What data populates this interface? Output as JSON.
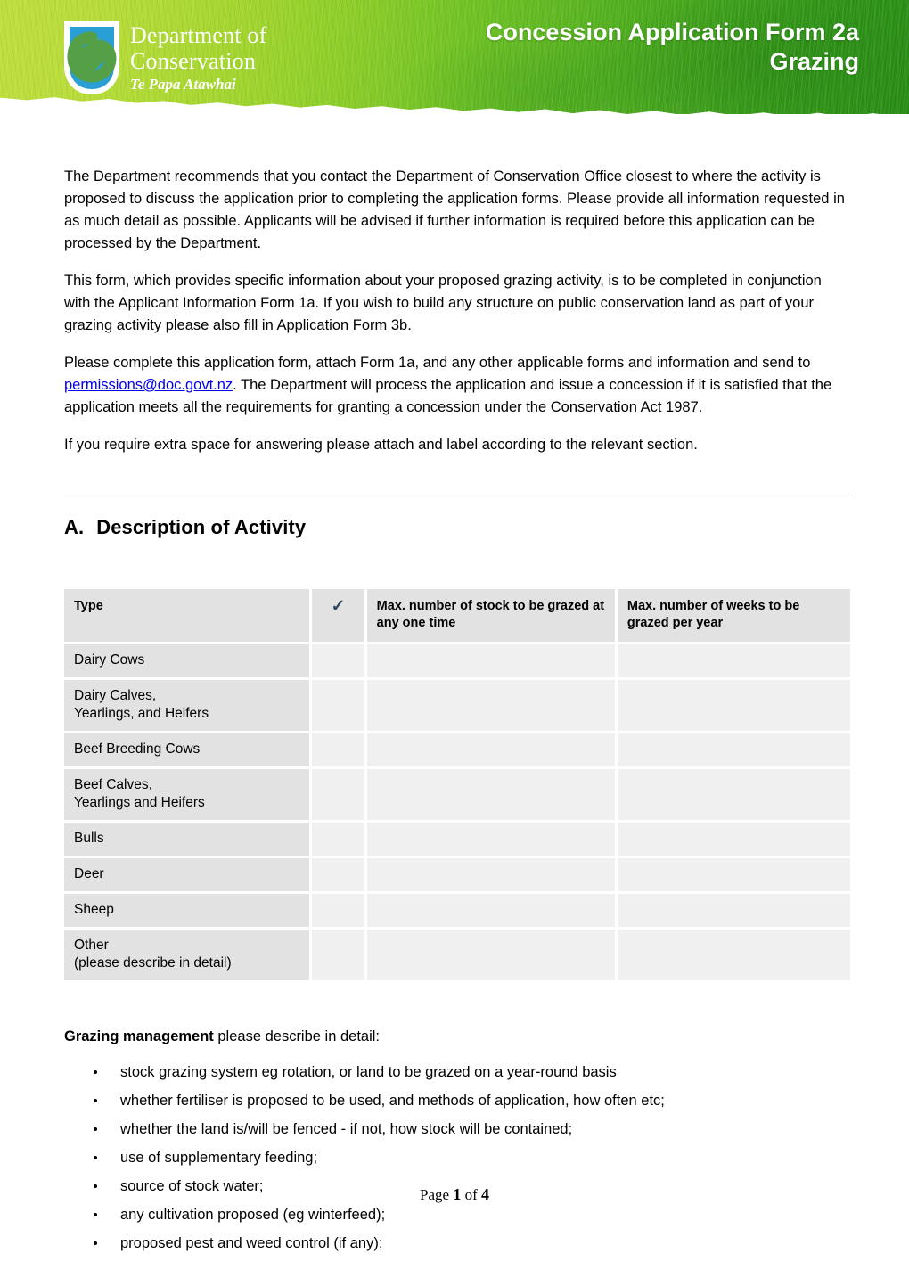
{
  "header": {
    "logo": {
      "line1": "Department of",
      "line2": "Conservation",
      "line3": "Te Papa Atawhai",
      "shield_blue": "#2a9fd6",
      "shield_green": "#55a046"
    },
    "title_line1": "Concession Application Form 2a",
    "title_line2": "Grazing",
    "banner_light_green": "#bede3c",
    "banner_dark_green": "#278c14"
  },
  "intro": {
    "p1": "The Department recommends that you contact the Department of Conservation Office closest to where the activity is proposed to discuss the application prior to completing the application forms.  Please provide all information requested in as much detail as possible.  Applicants will be advised if further information is required before this application can be processed by the Department.",
    "p2": "This form, which provides specific information about your proposed grazing activity, is to be completed in conjunction with the Applicant Information Form 1a.  If you wish to build any structure on public conservation land as part of your grazing activity please also fill in Application Form 3b.",
    "p3_before_link": "Please complete this application form, attach Form 1a, and any other applicable forms and information and send to ",
    "p3_link": "permissions@doc.govt.nz",
    "p3_after_link": ". The Department will process the application and issue a concession if it is satisfied that the application meets all the requirements for granting a concession under the Conservation Act 1987.",
    "p4": "If you require extra space for answering please attach and label according to the relevant section."
  },
  "section_a": {
    "letter": "A.",
    "title": "Description of Activity"
  },
  "table": {
    "headers": {
      "type": "Type",
      "tick": "✓",
      "stock": "Max. number of stock to be grazed at any one time",
      "weeks": "Max. number of weeks to be grazed per year"
    },
    "rows": [
      {
        "line1": "Dairy Cows",
        "line2": "",
        "tick": "",
        "stock": "",
        "weeks": ""
      },
      {
        "line1": "Dairy Calves,",
        "line2": "Yearlings, and Heifers",
        "tick": "",
        "stock": "",
        "weeks": ""
      },
      {
        "line1": "Beef Breeding Cows",
        "line2": "",
        "tick": "",
        "stock": "",
        "weeks": ""
      },
      {
        "line1": "Beef Calves,",
        "line2": "Yearlings and Heifers",
        "tick": "",
        "stock": "",
        "weeks": ""
      },
      {
        "line1": "Bulls",
        "line2": "",
        "tick": "",
        "stock": "",
        "weeks": ""
      },
      {
        "line1": "Deer",
        "line2": "",
        "tick": "",
        "stock": "",
        "weeks": ""
      },
      {
        "line1": "Sheep",
        "line2": "",
        "tick": "",
        "stock": "",
        "weeks": ""
      },
      {
        "line1": "Other",
        "line2": "(please describe in detail)",
        "tick": "",
        "stock": "",
        "weeks": ""
      }
    ]
  },
  "management": {
    "label_bold": "Grazing management",
    "label_rest": " please describe in detail:",
    "bullets": [
      "stock grazing system eg rotation, or land to be grazed on a year-round basis",
      "whether fertiliser is proposed to be used, and methods of application, how often etc;",
      "whether the land is/will be fenced - if not, how stock will be contained;",
      "use of supplementary feeding;",
      "source of stock water;",
      "any cultivation proposed (eg winterfeed);",
      "proposed pest and weed control (if any);"
    ]
  },
  "footer": {
    "prefix": "Page ",
    "page_number": "1",
    "middle": " of ",
    "total_pages": "4"
  }
}
